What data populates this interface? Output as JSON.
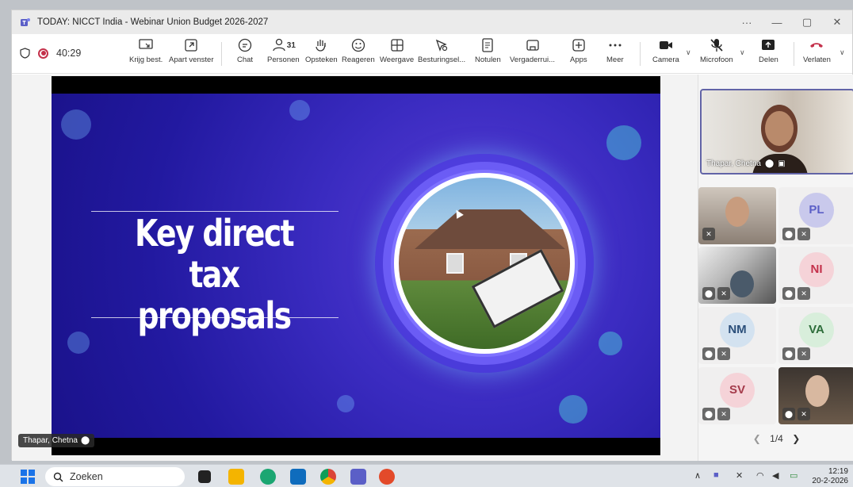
{
  "window": {
    "title": "TODAY: NICCT India - Webinar Union Budget 2026-2027",
    "controls": {
      "more": "···",
      "minimize": "—",
      "maximize": "▢",
      "close": "✕"
    }
  },
  "toolbar": {
    "timer": "40:29",
    "items": {
      "krijg": "Krijg best.",
      "apart": "Apart venster",
      "chat": "Chat",
      "personen": "Personen",
      "personen_count": "31",
      "opsteken": "Opsteken",
      "reageren": "Reageren",
      "weergave": "Weergave",
      "besturing": "Besturingsel...",
      "notulen": "Notulen",
      "vergader": "Vergaderrui...",
      "apps": "Apps",
      "meer": "Meer",
      "camera": "Camera",
      "microfoon": "Microfoon",
      "delen": "Delen",
      "verlaten": "Verlaten"
    },
    "colors": {
      "leave": "#c4314b",
      "accent": "#6264a7"
    }
  },
  "slide": {
    "title_line1": "Key direct tax",
    "title_line2": "proposals",
    "presenter": "Thapar, Chetna"
  },
  "gallery": {
    "main_tile": {
      "name": "Thapar, Chetna"
    },
    "tiles": [
      {
        "initials": "",
        "type": "video"
      },
      {
        "initials": "PL",
        "type": "avatar",
        "color": "#c9c9ec",
        "text_color": "#5b5fc7"
      },
      {
        "initials": "",
        "type": "video"
      },
      {
        "initials": "NI",
        "type": "avatar",
        "color": "#f5d3d8",
        "text_color": "#c4314b"
      },
      {
        "initials": "NM",
        "type": "avatar",
        "color": "#d3e2f0",
        "text_color": "#2b4f7a"
      },
      {
        "initials": "VA",
        "type": "avatar",
        "color": "#d8eedb",
        "text_color": "#2d6d3a"
      },
      {
        "initials": "SV",
        "type": "avatar",
        "color": "#f5d3d8",
        "text_color": "#a43a4a"
      },
      {
        "initials": "",
        "type": "video"
      }
    ],
    "pager": "1/4"
  },
  "taskbar": {
    "search_placeholder": "Zoeken",
    "time": "12:19",
    "date": "20-2-2026"
  }
}
